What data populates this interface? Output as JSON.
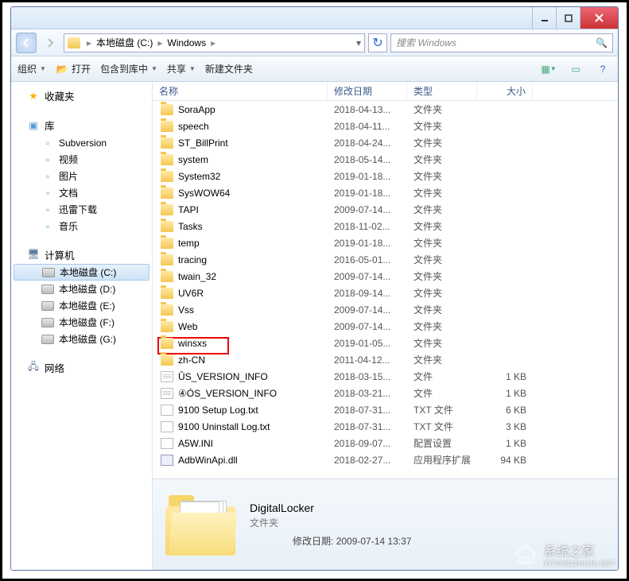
{
  "breadcrumb": {
    "parts": [
      "本地磁盘 (C:)",
      "Windows"
    ]
  },
  "search": {
    "placeholder": "搜索 Windows"
  },
  "toolbar": {
    "organize": "组织",
    "open": "打开",
    "include": "包含到库中",
    "share": "共享",
    "newfolder": "新建文件夹"
  },
  "sidebar": {
    "favorites": "收藏夹",
    "libraries": "库",
    "lib_items": [
      {
        "label": "Subversion",
        "icon": "doc"
      },
      {
        "label": "视频",
        "icon": "vid"
      },
      {
        "label": "图片",
        "icon": "img"
      },
      {
        "label": "文档",
        "icon": "doc"
      },
      {
        "label": "迅雷下载",
        "icon": "doc"
      },
      {
        "label": "音乐",
        "icon": "music"
      }
    ],
    "computer": "计算机",
    "drives": [
      {
        "label": "本地磁盘 (C:)",
        "selected": true
      },
      {
        "label": "本地磁盘 (D:)"
      },
      {
        "label": "本地磁盘 (E:)"
      },
      {
        "label": "本地磁盘 (F:)"
      },
      {
        "label": "本地磁盘 (G:)"
      }
    ],
    "network": "网络"
  },
  "columns": {
    "name": "名称",
    "date": "修改日期",
    "type": "类型",
    "size": "大小"
  },
  "files": [
    {
      "icon": "folder",
      "name": "SoraApp",
      "date": "2018-04-13...",
      "type": "文件夹",
      "size": ""
    },
    {
      "icon": "folder",
      "name": "speech",
      "date": "2018-04-11...",
      "type": "文件夹",
      "size": ""
    },
    {
      "icon": "folder",
      "name": "ST_BillPrint",
      "date": "2018-04-24...",
      "type": "文件夹",
      "size": ""
    },
    {
      "icon": "folder",
      "name": "system",
      "date": "2018-05-14...",
      "type": "文件夹",
      "size": ""
    },
    {
      "icon": "folder",
      "name": "System32",
      "date": "2019-01-18...",
      "type": "文件夹",
      "size": ""
    },
    {
      "icon": "folder",
      "name": "SysWOW64",
      "date": "2019-01-18...",
      "type": "文件夹",
      "size": ""
    },
    {
      "icon": "folder",
      "name": "TAPI",
      "date": "2009-07-14...",
      "type": "文件夹",
      "size": ""
    },
    {
      "icon": "folder",
      "name": "Tasks",
      "date": "2018-11-02...",
      "type": "文件夹",
      "size": ""
    },
    {
      "icon": "folder",
      "name": "temp",
      "date": "2019-01-18...",
      "type": "文件夹",
      "size": ""
    },
    {
      "icon": "folder",
      "name": "tracing",
      "date": "2016-05-01...",
      "type": "文件夹",
      "size": ""
    },
    {
      "icon": "folder",
      "name": "twain_32",
      "date": "2009-07-14...",
      "type": "文件夹",
      "size": ""
    },
    {
      "icon": "folder",
      "name": "UV6R",
      "date": "2018-09-14...",
      "type": "文件夹",
      "size": ""
    },
    {
      "icon": "folder",
      "name": "Vss",
      "date": "2009-07-14...",
      "type": "文件夹",
      "size": ""
    },
    {
      "icon": "folder",
      "name": "Web",
      "date": "2009-07-14...",
      "type": "文件夹",
      "size": ""
    },
    {
      "icon": "folder",
      "name": "winsxs",
      "date": "2019-01-05...",
      "type": "文件夹",
      "size": "",
      "highlight": true
    },
    {
      "icon": "folder",
      "name": "zh-CN",
      "date": "2011-04-12...",
      "type": "文件夹",
      "size": ""
    },
    {
      "icon": "file",
      "name": "ÛS_VERSION_INFO",
      "date": "2018-03-15...",
      "type": "文件",
      "size": "1 KB"
    },
    {
      "icon": "file",
      "name": "④ÓS_VERSION_INFO",
      "date": "2018-03-21...",
      "type": "文件",
      "size": "1 KB"
    },
    {
      "icon": "txt",
      "name": "9100 Setup Log.txt",
      "date": "2018-07-31...",
      "type": "TXT 文件",
      "size": "6 KB"
    },
    {
      "icon": "txt",
      "name": "9100 Uninstall Log.txt",
      "date": "2018-07-31...",
      "type": "TXT 文件",
      "size": "3 KB"
    },
    {
      "icon": "ini",
      "name": "A5W.INI",
      "date": "2018-09-07...",
      "type": "配置设置",
      "size": "1 KB"
    },
    {
      "icon": "dll",
      "name": "AdbWinApi.dll",
      "date": "2018-02-27...",
      "type": "应用程序扩展",
      "size": "94 KB"
    }
  ],
  "details": {
    "name": "DigitalLocker",
    "type": "文件夹",
    "mod_label": "修改日期:",
    "mod_value": "2009-07-14 13:37"
  },
  "watermark": {
    "text": "系统之家",
    "url": "XITONGZHIJIA.NET"
  }
}
